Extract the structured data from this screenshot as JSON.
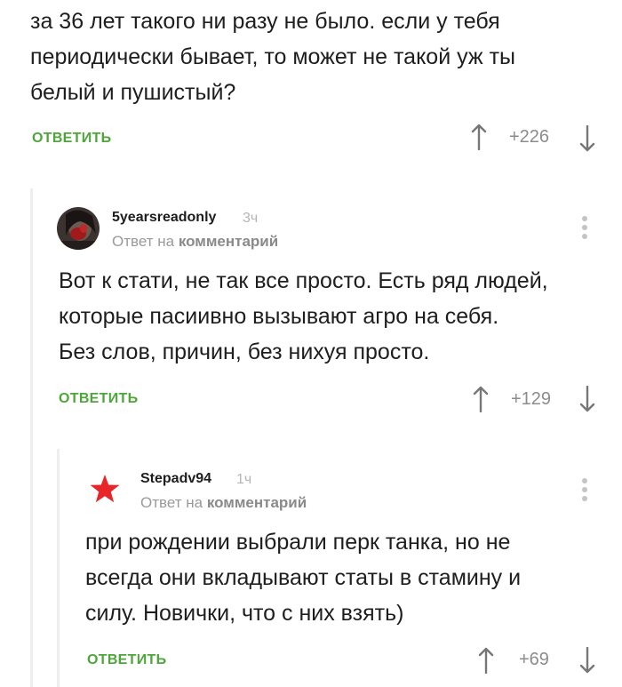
{
  "comment_top": {
    "lines": [
      "за 36 лет такого ни разу не было. если у тебя",
      "периодически бывает, то может не такой уж ты",
      "белый и пушистый?"
    ],
    "reply_label": "ОТВЕТИТЬ",
    "rating": "+226"
  },
  "comment_1": {
    "username": "5yearsreadonly",
    "time": "3ч",
    "reply_to_prefix": "Ответ на",
    "reply_to_target": "комментарий",
    "lines": [
      "Вот к стати, не так все просто. Есть ряд людей,",
      "которые пасиивно вызывают агро на себя.",
      "Без слов, причин, без нихуя просто."
    ],
    "reply_label": "ОТВЕТИТЬ",
    "rating": "+129"
  },
  "comment_2": {
    "username": "Stepadv94",
    "time": "1ч",
    "reply_to_prefix": "Ответ на",
    "reply_to_target": "комментарий",
    "lines": [
      "при рождении выбрали перк танка, но не",
      "всегда они вкладывают статы в стамину и",
      "силу. Новички, что с них взять)"
    ],
    "reply_label": "ОТВЕТИТЬ",
    "rating": "+69"
  },
  "colors": {
    "accent_green": "#4ea63a",
    "thread_line": "#eeeeee",
    "muted_text": "#8c8c8c",
    "star_red": "#e8262a"
  },
  "icons": {
    "upvote": "arrow-up-icon",
    "downvote": "arrow-down-icon",
    "menu": "more-vertical-icon",
    "avatar_2": "red-star-icon"
  }
}
